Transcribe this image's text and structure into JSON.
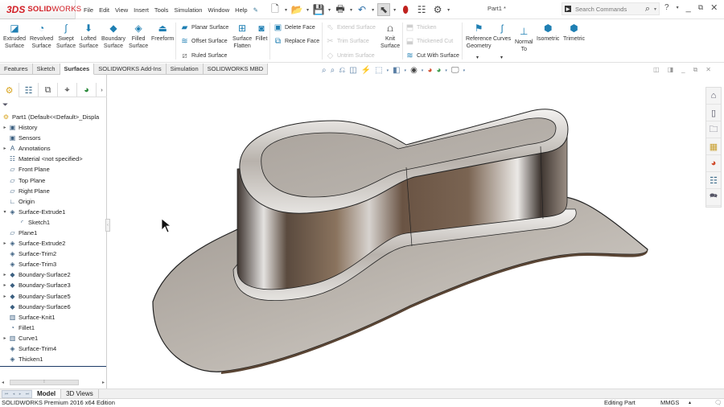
{
  "app": {
    "brand_prefix": "SOLID",
    "brand_suffix": "WORKS",
    "logo_mark": "3DS"
  },
  "menu": [
    "File",
    "Edit",
    "View",
    "Insert",
    "Tools",
    "Simulation",
    "Window",
    "Help"
  ],
  "document_title": "Part1 *",
  "search": {
    "placeholder": "Search Commands"
  },
  "ribbon": {
    "large_buttons": [
      {
        "label1": "Extruded",
        "label2": "Surface"
      },
      {
        "label1": "Revolved",
        "label2": "Surface"
      },
      {
        "label1": "Swept",
        "label2": "Surface"
      },
      {
        "label1": "Lofted",
        "label2": "Surface"
      },
      {
        "label1": "Boundary",
        "label2": "Surface"
      },
      {
        "label1": "Filled",
        "label2": "Surface"
      },
      {
        "label1": "Freeform",
        "label2": ""
      }
    ],
    "surface_group": [
      "Planar Surface",
      "Offset Surface",
      "Ruled Surface"
    ],
    "flatten": {
      "label1": "Surface",
      "label2": "Flatten"
    },
    "fillet": "Fillet",
    "face_group": [
      "Delete Face",
      "Replace Face"
    ],
    "trim_group": [
      "Extend Surface",
      "Trim Surface",
      "Untrim Surface"
    ],
    "knit": {
      "label1": "Knit",
      "label2": "Surface"
    },
    "thicken_group": [
      "Thicken",
      "Thickened Cut",
      "Cut With Surface"
    ],
    "ref_geometry": {
      "label1": "Reference",
      "label2": "Geometry"
    },
    "curves": "Curves",
    "normal_to": {
      "label1": "Normal",
      "label2": "To"
    },
    "isometric": "Isometric",
    "trimetric": "Trimetric"
  },
  "tabs": [
    "Features",
    "Sketch",
    "Surfaces",
    "SOLIDWORKS Add-Ins",
    "Simulation",
    "SOLIDWORKS MBD"
  ],
  "active_tab": "Surfaces",
  "tree": {
    "root": "Part1  (Default<<Default>_Displa",
    "items": [
      {
        "label": "History",
        "expand": "▸",
        "icon": "▣",
        "indent": 0
      },
      {
        "label": "Sensors",
        "expand": "",
        "icon": "▣",
        "indent": 0
      },
      {
        "label": "Annotations",
        "expand": "▸",
        "icon": "A",
        "indent": 0
      },
      {
        "label": "Material <not specified>",
        "expand": "",
        "icon": "☷",
        "indent": 0
      },
      {
        "label": "Front Plane",
        "expand": "",
        "icon": "▱",
        "indent": 0
      },
      {
        "label": "Top Plane",
        "expand": "",
        "icon": "▱",
        "indent": 0
      },
      {
        "label": "Right Plane",
        "expand": "",
        "icon": "▱",
        "indent": 0
      },
      {
        "label": "Origin",
        "expand": "",
        "icon": "∟",
        "indent": 0
      },
      {
        "label": "Surface-Extrude1",
        "expand": "▾",
        "icon": "◈",
        "indent": 0
      },
      {
        "label": "Sketch1",
        "expand": "",
        "icon": "◜",
        "indent": 1
      },
      {
        "label": "Plane1",
        "expand": "",
        "icon": "▱",
        "indent": 0
      },
      {
        "label": "Surface-Extrude2",
        "expand": "▸",
        "icon": "◈",
        "indent": 0
      },
      {
        "label": "Surface-Trim2",
        "expand": "",
        "icon": "◈",
        "indent": 0
      },
      {
        "label": "Surface-Trim3",
        "expand": "",
        "icon": "◈",
        "indent": 0
      },
      {
        "label": "Boundary-Surface2",
        "expand": "▸",
        "icon": "◆",
        "indent": 0
      },
      {
        "label": "Boundary-Surface3",
        "expand": "▸",
        "icon": "◆",
        "indent": 0
      },
      {
        "label": "Boundary-Surface5",
        "expand": "▸",
        "icon": "◆",
        "indent": 0
      },
      {
        "label": "Boundary-Surface6",
        "expand": "",
        "icon": "◆",
        "indent": 0
      },
      {
        "label": "Surface-Knit1",
        "expand": "",
        "icon": "▥",
        "indent": 0
      },
      {
        "label": "Fillet1",
        "expand": "",
        "icon": "◔",
        "indent": 0
      },
      {
        "label": "Curve1",
        "expand": "▸",
        "icon": "▥",
        "indent": 0
      },
      {
        "label": "Surface-Trim4",
        "expand": "",
        "icon": "◈",
        "indent": 0
      },
      {
        "label": "Thicken1",
        "expand": "",
        "icon": "◈",
        "indent": 0
      }
    ]
  },
  "bottom_tabs": [
    "Model",
    "3D Views"
  ],
  "active_bottom_tab": "Model",
  "status": {
    "edition": "SOLIDWORKS Premium 2016 x64 Edition",
    "mode": "Editing Part",
    "units": "MMGS"
  },
  "colors": {
    "brand_red": "#d32027",
    "ribbon_icon_blue": "#1f7fb3",
    "tree_line": "#1c3a66"
  }
}
